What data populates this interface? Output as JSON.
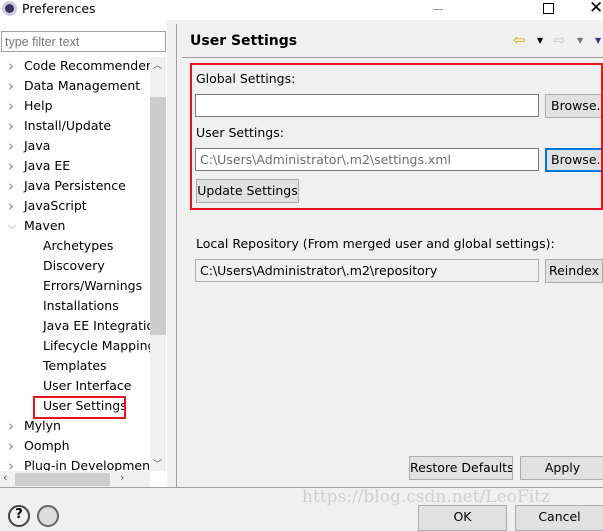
{
  "window": {
    "title": "Preferences",
    "minimize_icon": "minimize-icon",
    "maximize_icon": "maximize-icon",
    "close_icon": "close-icon"
  },
  "sidebar": {
    "filter_placeholder": "type filter text",
    "items": [
      {
        "label": "Code Recommenders",
        "level": 0,
        "expanded": false
      },
      {
        "label": "Data Management",
        "level": 0,
        "expanded": false
      },
      {
        "label": "Help",
        "level": 0,
        "expanded": false
      },
      {
        "label": "Install/Update",
        "level": 0,
        "expanded": false
      },
      {
        "label": "Java",
        "level": 0,
        "expanded": false
      },
      {
        "label": "Java EE",
        "level": 0,
        "expanded": false
      },
      {
        "label": "Java Persistence",
        "level": 0,
        "expanded": false
      },
      {
        "label": "JavaScript",
        "level": 0,
        "expanded": false
      },
      {
        "label": "Maven",
        "level": 0,
        "expanded": true
      },
      {
        "label": "Archetypes",
        "level": 1
      },
      {
        "label": "Discovery",
        "level": 1
      },
      {
        "label": "Errors/Warnings",
        "level": 1
      },
      {
        "label": "Installations",
        "level": 1
      },
      {
        "label": "Java EE Integration",
        "level": 1
      },
      {
        "label": "Lifecycle Mapping",
        "level": 1
      },
      {
        "label": "Templates",
        "level": 1
      },
      {
        "label": "User Interface",
        "level": 1
      },
      {
        "label": "User Settings",
        "level": 1,
        "selected": true
      },
      {
        "label": "Mylyn",
        "level": 0,
        "expanded": false
      },
      {
        "label": "Oomph",
        "level": 0,
        "expanded": false
      },
      {
        "label": "Plug-in Development",
        "level": 0,
        "expanded": false
      }
    ]
  },
  "page": {
    "title": "User Settings",
    "global_settings_label": "Global Settings:",
    "global_settings_value": "",
    "browse_label": "Browse...",
    "user_settings_label": "User Settings:",
    "user_settings_value": "C:\\Users\\Administrator\\.m2\\settings.xml",
    "update_settings_label": "Update Settings",
    "local_repo_label": "Local Repository (From merged user and global settings):",
    "local_repo_value": "C:\\Users\\Administrator\\.m2\\repository",
    "reindex_label": "Reindex",
    "restore_defaults_label": "Restore Defaults",
    "apply_label": "Apply"
  },
  "footer": {
    "ok_label": "OK",
    "cancel_label": "Cancel",
    "watermark": "https://blog.csdn.net/LeoFitz"
  },
  "colors": {
    "highlight": "#e8121f",
    "focus": "#0078d7"
  }
}
